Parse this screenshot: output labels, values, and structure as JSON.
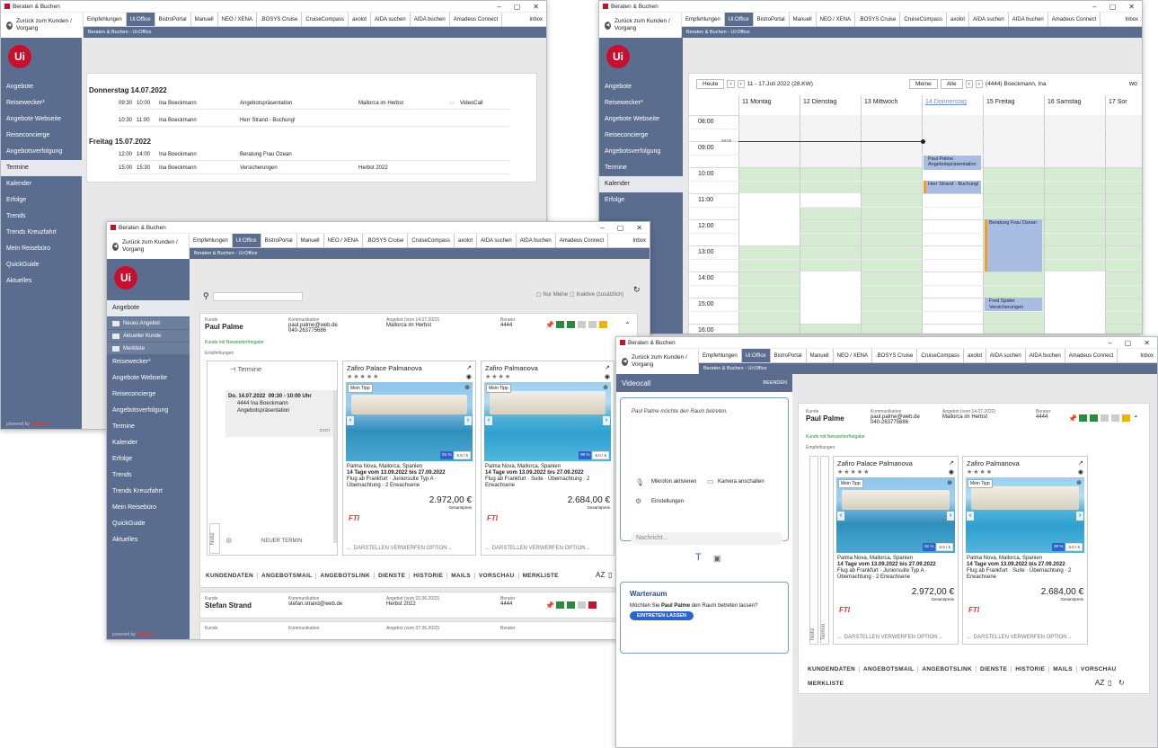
{
  "app_title": "Beraten & Buchen",
  "back_label": "Zurück zum Kunden / Vorgang",
  "tabs": [
    "Empfehlungen",
    "Ui:Office",
    "BistroPortal",
    "Manuell",
    "NEO / XENA",
    ".BOSYS Cruise",
    "CruiseCompass",
    "axolot",
    "AIDA suchen",
    "AIDA buchen",
    "Amadeus Connect",
    "Inbox"
  ],
  "breadcrumb": "Beraten & Buchen - Ui:Office",
  "logo": "Ui",
  "nav": [
    "Angebote",
    "Reisewecker³",
    "Angebote Webseite",
    "Reiseconcierge",
    "Angebotsverfolgung",
    "Termine",
    "Kalender",
    "Erfolge",
    "Trends",
    "Trends Kreuzfahrt",
    "Mein Reisebüro",
    "QuickGuide",
    "Aktuelles"
  ],
  "subnav": [
    "Neues Angebot",
    "Aktueller Kunde",
    "Merkliste"
  ],
  "powered": "powered by",
  "bosys": ".BOSYS",
  "termine": {
    "day1": "Donnerstag 14.07.2022",
    "day2": "Freitag 15.07.2022",
    "rows": [
      {
        "from": "09:30",
        "to": "10:00",
        "who": "Ina Boeckmann",
        "what": "Angebotspräsentation",
        "where": "Mallorca im Herbst",
        "extra": "VideoCall"
      },
      {
        "from": "10:30",
        "to": "11:00",
        "who": "Ina Boeckmann",
        "what": "Herr Strand - Buchung!",
        "where": "",
        "extra": ""
      },
      {
        "from": "12:00",
        "to": "14:00",
        "who": "Ina Boeckmann",
        "what": "Beratung Frau Ozean",
        "where": "",
        "extra": ""
      },
      {
        "from": "15:00",
        "to": "15:30",
        "who": "Ina Boeckmann",
        "what": "Versicherungen",
        "where": "Herbst 2022",
        "extra": ""
      }
    ]
  },
  "calendar": {
    "today": "Heute",
    "range": "11 - 17.Juli 2022 (28.KW)",
    "mine": "Meine",
    "all": "Alle",
    "person": "(4444) Boeckmann, Ina",
    "wo": "wo",
    "days": [
      {
        "n": "11",
        "d": "Montag"
      },
      {
        "n": "12",
        "d": "Dienstag"
      },
      {
        "n": "13",
        "d": "Mittwoch"
      },
      {
        "n": "14",
        "d": "Donnerstag"
      },
      {
        "n": "15",
        "d": "Freitag"
      },
      {
        "n": "16",
        "d": "Samstag"
      },
      {
        "n": "17",
        "d": "Sor"
      }
    ],
    "hours": [
      "08:00",
      "09:00",
      "10:00",
      "11:00",
      "12:00",
      "13:00",
      "14:00",
      "15:00",
      "16:00"
    ],
    "now": "09:00",
    "ev1a": "Paul Palme",
    "ev1b": "Angebotspräsentation",
    "ev2": "Herr Strand - Buchung!",
    "ev3": "Beratung Frau Ozean",
    "ev4a": "Fred Spider",
    "ev4b": "Versicherungen"
  },
  "filter": {
    "meine": "Nur Meine",
    "inaktive": "Inaktive (zusätzlich)"
  },
  "customer": {
    "kunde_lbl": "Kunde",
    "name": "Paul Palme",
    "komm_lbl": "Kommunikation",
    "email": "paul.palme@web.de",
    "phone": "040-263775686",
    "angebot_lbl": "Angebot (vom 14.07.2022)",
    "angebot": "Mallorca im Herbst",
    "berater_lbl": "Berater",
    "berater": "4444",
    "newsletter": "Kunde mit Newsletterfreigabe",
    "empf": "Empfehlungen"
  },
  "termin_card": {
    "title": "Termine",
    "date": "Do. 14.07.2022",
    "time": "09:30 - 10:00 Uhr",
    "who": "4444 Ina Boeckmann",
    "what": "Angebotspräsentation",
    "new": "NEUER TERMIN",
    "notiz": "Notiz",
    "termin": "Termin"
  },
  "offers": [
    {
      "name": "Zafiro Palace Palmanova",
      "stars": "★★★★★",
      "tip": "Mein Tipp",
      "r1": "91 %",
      "r2": "5.5 / 6",
      "loc": "Palma Nova, Mallorca, Spanien",
      "l1": "14 Tage vom 13.09.2022 bis 27.09.2022",
      "l2": "Flug ab Frankfurt · Juniorsuite Typ A ·",
      "l3": "Übernachtung · 2 Erwachsene",
      "price": "2.972,00 €",
      "gp": "Gesamtpreis"
    },
    {
      "name": "Zafiro Palmanova",
      "stars": "★★★★",
      "tip": "Mein Tipp",
      "r1": "90 %",
      "r2": "5.0 / 6",
      "loc": "Palma Nova, Mallorca, Spanien",
      "l1": "14 Tage vom 13.09.2022 bis 27.09.2022",
      "l2": "Flug ab Frankfurt · Suite · Übernachtung · 2",
      "l3": "Erwachsene",
      "price": "2.684,00 €",
      "gp": "Gesamtpreis"
    }
  ],
  "fti": "FTI",
  "offer_actions": "← DARSTELLEN   VERWERFEN   OPTION→",
  "bottom_tabs": [
    "KUNDENDATEN",
    "ANGEBOTSMAIL",
    "ANGEBOTSLINK",
    "DIENSTE",
    "HISTORIE",
    "MAILS",
    "VORSCHAU",
    "MERKLISTE"
  ],
  "stefan": {
    "name": "Stefan Strand",
    "email": "stefan.strand@web.de",
    "angebot_lbl": "Angebot (vom 22.06.2022)",
    "angebot": "Herbst 2022",
    "berater": "4444"
  },
  "third_angebot_lbl": "Angebot (vom 07.06.2022)",
  "videocall": {
    "title": "Videocall",
    "end": "BEENDEN",
    "msg": "Paul Palme möchte den Raum betreten.",
    "mic": "Mikrofon aktivieren",
    "cam": "Kamera anschalten",
    "settings": "Einstellungen",
    "placeholder": "Nachricht...",
    "wait_title": "Warteraum",
    "wait_q1": "Möchten Sie ",
    "wait_name": "Paul Palme",
    "wait_q2": " den Raum betreten lassen?",
    "enter": "EINTRETEN LASSEN"
  }
}
